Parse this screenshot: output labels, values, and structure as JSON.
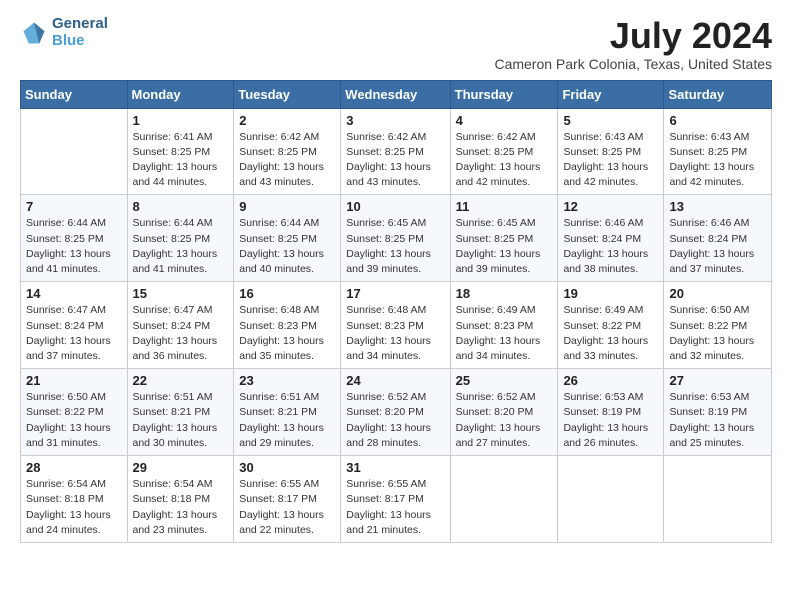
{
  "header": {
    "logo_line1": "General",
    "logo_line2": "Blue",
    "month": "July 2024",
    "location": "Cameron Park Colonia, Texas, United States"
  },
  "weekdays": [
    "Sunday",
    "Monday",
    "Tuesday",
    "Wednesday",
    "Thursday",
    "Friday",
    "Saturday"
  ],
  "weeks": [
    [
      {
        "day": "",
        "info": ""
      },
      {
        "day": "1",
        "info": "Sunrise: 6:41 AM\nSunset: 8:25 PM\nDaylight: 13 hours\nand 44 minutes."
      },
      {
        "day": "2",
        "info": "Sunrise: 6:42 AM\nSunset: 8:25 PM\nDaylight: 13 hours\nand 43 minutes."
      },
      {
        "day": "3",
        "info": "Sunrise: 6:42 AM\nSunset: 8:25 PM\nDaylight: 13 hours\nand 43 minutes."
      },
      {
        "day": "4",
        "info": "Sunrise: 6:42 AM\nSunset: 8:25 PM\nDaylight: 13 hours\nand 42 minutes."
      },
      {
        "day": "5",
        "info": "Sunrise: 6:43 AM\nSunset: 8:25 PM\nDaylight: 13 hours\nand 42 minutes."
      },
      {
        "day": "6",
        "info": "Sunrise: 6:43 AM\nSunset: 8:25 PM\nDaylight: 13 hours\nand 42 minutes."
      }
    ],
    [
      {
        "day": "7",
        "info": "Sunrise: 6:44 AM\nSunset: 8:25 PM\nDaylight: 13 hours\nand 41 minutes."
      },
      {
        "day": "8",
        "info": "Sunrise: 6:44 AM\nSunset: 8:25 PM\nDaylight: 13 hours\nand 41 minutes."
      },
      {
        "day": "9",
        "info": "Sunrise: 6:44 AM\nSunset: 8:25 PM\nDaylight: 13 hours\nand 40 minutes."
      },
      {
        "day": "10",
        "info": "Sunrise: 6:45 AM\nSunset: 8:25 PM\nDaylight: 13 hours\nand 39 minutes."
      },
      {
        "day": "11",
        "info": "Sunrise: 6:45 AM\nSunset: 8:25 PM\nDaylight: 13 hours\nand 39 minutes."
      },
      {
        "day": "12",
        "info": "Sunrise: 6:46 AM\nSunset: 8:24 PM\nDaylight: 13 hours\nand 38 minutes."
      },
      {
        "day": "13",
        "info": "Sunrise: 6:46 AM\nSunset: 8:24 PM\nDaylight: 13 hours\nand 37 minutes."
      }
    ],
    [
      {
        "day": "14",
        "info": "Sunrise: 6:47 AM\nSunset: 8:24 PM\nDaylight: 13 hours\nand 37 minutes."
      },
      {
        "day": "15",
        "info": "Sunrise: 6:47 AM\nSunset: 8:24 PM\nDaylight: 13 hours\nand 36 minutes."
      },
      {
        "day": "16",
        "info": "Sunrise: 6:48 AM\nSunset: 8:23 PM\nDaylight: 13 hours\nand 35 minutes."
      },
      {
        "day": "17",
        "info": "Sunrise: 6:48 AM\nSunset: 8:23 PM\nDaylight: 13 hours\nand 34 minutes."
      },
      {
        "day": "18",
        "info": "Sunrise: 6:49 AM\nSunset: 8:23 PM\nDaylight: 13 hours\nand 34 minutes."
      },
      {
        "day": "19",
        "info": "Sunrise: 6:49 AM\nSunset: 8:22 PM\nDaylight: 13 hours\nand 33 minutes."
      },
      {
        "day": "20",
        "info": "Sunrise: 6:50 AM\nSunset: 8:22 PM\nDaylight: 13 hours\nand 32 minutes."
      }
    ],
    [
      {
        "day": "21",
        "info": "Sunrise: 6:50 AM\nSunset: 8:22 PM\nDaylight: 13 hours\nand 31 minutes."
      },
      {
        "day": "22",
        "info": "Sunrise: 6:51 AM\nSunset: 8:21 PM\nDaylight: 13 hours\nand 30 minutes."
      },
      {
        "day": "23",
        "info": "Sunrise: 6:51 AM\nSunset: 8:21 PM\nDaylight: 13 hours\nand 29 minutes."
      },
      {
        "day": "24",
        "info": "Sunrise: 6:52 AM\nSunset: 8:20 PM\nDaylight: 13 hours\nand 28 minutes."
      },
      {
        "day": "25",
        "info": "Sunrise: 6:52 AM\nSunset: 8:20 PM\nDaylight: 13 hours\nand 27 minutes."
      },
      {
        "day": "26",
        "info": "Sunrise: 6:53 AM\nSunset: 8:19 PM\nDaylight: 13 hours\nand 26 minutes."
      },
      {
        "day": "27",
        "info": "Sunrise: 6:53 AM\nSunset: 8:19 PM\nDaylight: 13 hours\nand 25 minutes."
      }
    ],
    [
      {
        "day": "28",
        "info": "Sunrise: 6:54 AM\nSunset: 8:18 PM\nDaylight: 13 hours\nand 24 minutes."
      },
      {
        "day": "29",
        "info": "Sunrise: 6:54 AM\nSunset: 8:18 PM\nDaylight: 13 hours\nand 23 minutes."
      },
      {
        "day": "30",
        "info": "Sunrise: 6:55 AM\nSunset: 8:17 PM\nDaylight: 13 hours\nand 22 minutes."
      },
      {
        "day": "31",
        "info": "Sunrise: 6:55 AM\nSunset: 8:17 PM\nDaylight: 13 hours\nand 21 minutes."
      },
      {
        "day": "",
        "info": ""
      },
      {
        "day": "",
        "info": ""
      },
      {
        "day": "",
        "info": ""
      }
    ]
  ]
}
